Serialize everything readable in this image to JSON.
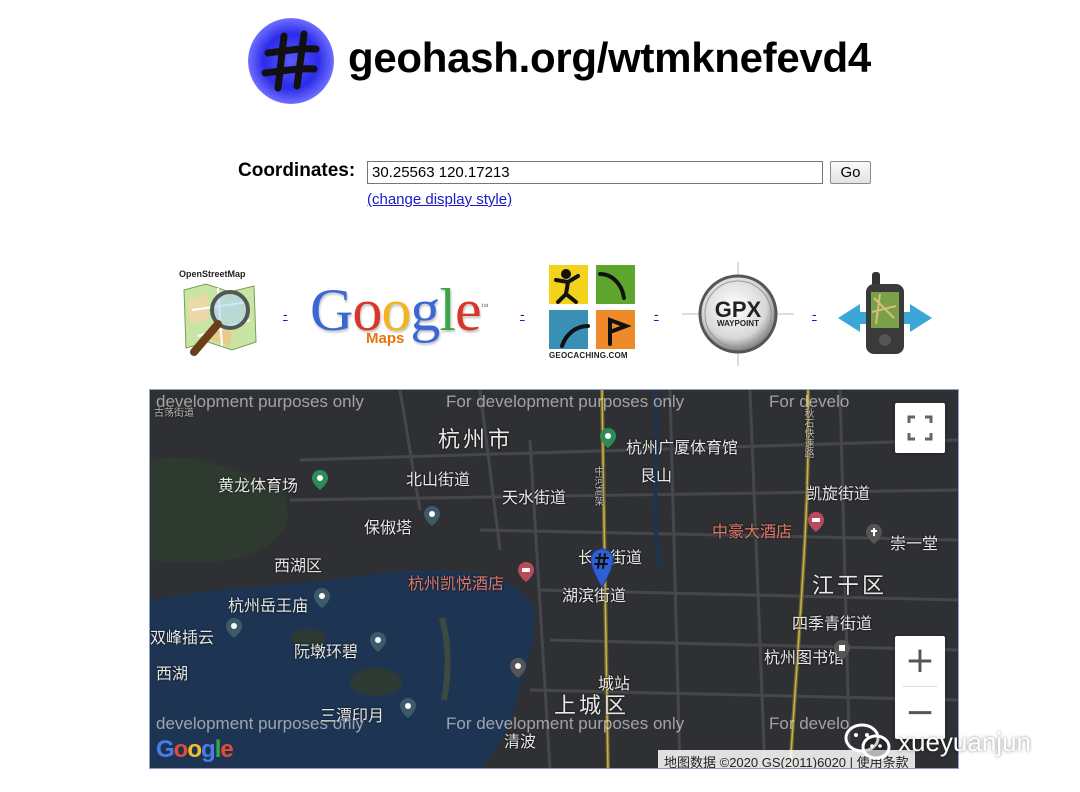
{
  "header": {
    "title": "geohash.org/wtmknefevd4",
    "logo_icon": "hash-logo-icon"
  },
  "form": {
    "coordinates_label": "Coordinates:",
    "coordinates_value": "30.25563 120.17213",
    "go_label": "Go",
    "change_style_link": "(change display style)"
  },
  "services": {
    "osm_caption": "OpenStreetMap",
    "google_letters": [
      "G",
      "o",
      "o",
      "g",
      "l",
      "e"
    ],
    "google_tm": "™",
    "google_maps_word": "Maps",
    "geocaching_caption": "GEOCACHING.COM",
    "gpx_title": "GPX",
    "gpx_subtitle": "WAYPOINT",
    "separator": "-",
    "colors": {
      "google_blue": "#3a66d8",
      "google_red": "#d9352a",
      "google_yellow": "#f2b51c",
      "google_green": "#3aa648"
    }
  },
  "map": {
    "dev_notice": "For development purposes only",
    "dev_notice_cut": "development purposes only",
    "dev_notice_partial": "For develo",
    "labels": {
      "city": "杭州市",
      "gym": "杭州广厦体育馆",
      "huanglong": "黄龙体育场",
      "beishan": "北山街道",
      "tianshui": "天水街道",
      "baochu": "保俶塔",
      "xihu": "西湖区",
      "hotel_kaiyue": "杭州凯悦酒店",
      "yuewang": "杭州岳王庙",
      "shuangfeng": "双峰插云",
      "ruandun": "阮墩环碧",
      "xihu_lake": "西湖",
      "santan": "三潭印月",
      "shangcheng": "上城区",
      "qingbo": "清波",
      "hubin": "湖滨街道",
      "changqing": "长庆街道",
      "liangshan": "艮山",
      "kaixuan": "凯旋街道",
      "zhonghao": "中豪大酒店",
      "chongyi": "崇一堂",
      "jianggan": "江干区",
      "siji": "四季青街道",
      "library": "杭州图书馆",
      "gudang": "古荡街道",
      "zhongshan": "中河高架",
      "qiushi": "秋石快速路",
      "chengzhan": "城站"
    },
    "attribution": "地图数据 ©2020 GS(2011)6020",
    "terms": "使用条款",
    "zoom_in": "+",
    "zoom_out": "−",
    "google_watermark": [
      "G",
      "o",
      "o",
      "g",
      "l",
      "e"
    ],
    "colors": {
      "background": "#2f3033",
      "water": "#1d3553",
      "road": "#4a4b4f",
      "highway": "#7a6a2a",
      "pin": "#2f5fd0"
    }
  },
  "overlay": {
    "wechat_watermark": "xueyuanjun"
  }
}
